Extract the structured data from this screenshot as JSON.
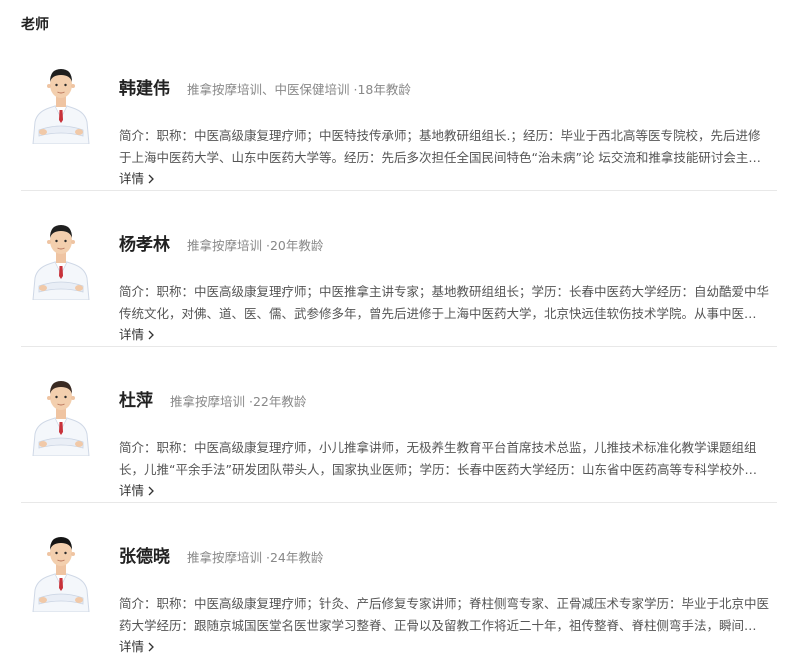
{
  "section": {
    "title": "老师"
  },
  "teachers": [
    {
      "name": "韩建伟",
      "tags": "推拿按摩培训、中医保健培训 ·18年教龄",
      "intro_lines": [
        "简介：职称：中医高级康复理疗师；中医特技传承师；基地教研组组长.；经历：毕业于西北高等医专院校，先后进修",
        "于上海中医药大学、山东中医药大学等。经历：先后多次担任全国民间特色“治未病”论 坛交流和推拿技能研讨会主…"
      ],
      "detail_label": "详情",
      "hair": "#1f1f1f"
    },
    {
      "name": "杨孝林",
      "tags": "推拿按摩培训 ·20年教龄",
      "intro_lines": [
        "简介：职称：中医高级康复理疗师；中医推拿主讲专家；基地教研组组长；学历：长春中医药大学经历：自幼酷爱中华",
        "传统文化，对佛、道、医、儒、武参修多年，曾先后进修于上海中医药大学，北京快远佳软伤技术学院。从事中医…"
      ],
      "detail_label": "详情",
      "hair": "#1f1f1f"
    },
    {
      "name": "杜萍",
      "tags": "推拿按摩培训 ·22年教龄",
      "intro_lines": [
        "简介：职称：中医高级康复理疗师，小儿推拿讲师，无极养生教育平台首席技术总监，儿推技术标准化教学课题组组",
        "长，儿推“平余手法”研发团队带头人，国家执业医师；学历：长春中医药大学经历：山东省中医药高等专科学校外…"
      ],
      "detail_label": "详情",
      "hair": "#3a2a22"
    },
    {
      "name": "张德晓",
      "tags": "推拿按摩培训 ·24年教龄",
      "intro_lines": [
        "简介：职称：中医高级康复理疗师；针灸、产后修复专家讲师；脊柱侧弯专家、正骨减压术专家学历：毕业于北京中医",
        "药大学经历：跟随京城国医堂名医世家学习整脊、正骨以及留教工作将近二十年，祖传整脊、脊柱侧弯手法，瞬间…"
      ],
      "detail_label": "详情",
      "hair": "#141414"
    }
  ]
}
